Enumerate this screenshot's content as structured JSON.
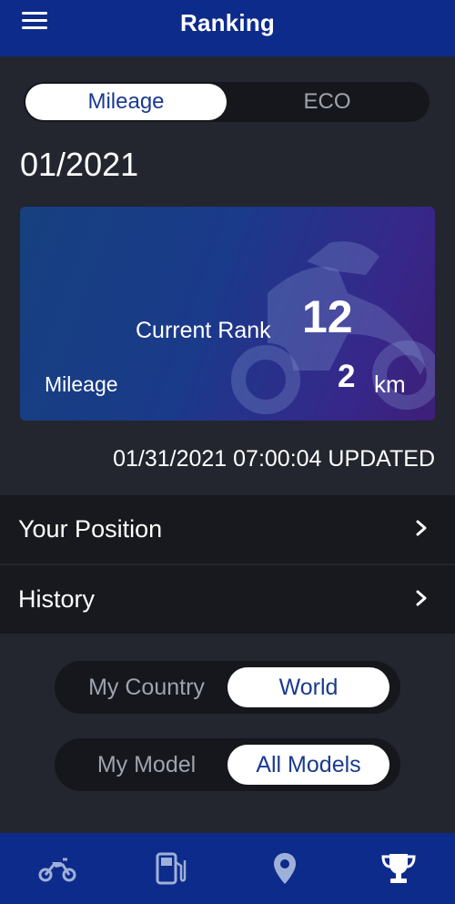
{
  "header": {
    "title": "Ranking",
    "menu_icon": "hamburger-menu-icon"
  },
  "metric_toggle": {
    "options": [
      "Mileage",
      "ECO"
    ],
    "selected": "Mileage"
  },
  "period": "01/2021",
  "rank_card": {
    "rank_label": "Current Rank",
    "rank_value": "12",
    "mileage_label": "Mileage",
    "mileage_value": "2",
    "mileage_unit": "km",
    "background_icon": "motorcycle-icon",
    "colors": {
      "start": "#16407f",
      "end": "#3d1f78"
    }
  },
  "updated_text": "01/31/2021 07:00:04 UPDATED",
  "rows": [
    {
      "label": "Your Position",
      "icon": "chevron-right-icon"
    },
    {
      "label": "History",
      "icon": "chevron-right-icon"
    }
  ],
  "region_toggle": {
    "options": [
      "My Country",
      "World"
    ],
    "selected": "World"
  },
  "model_toggle": {
    "options": [
      "My Model",
      "All Models"
    ],
    "selected": "All Models"
  },
  "tabbar": {
    "tabs": [
      {
        "icon": "motorcycle-icon",
        "active": false
      },
      {
        "icon": "fuel-pump-icon",
        "active": false
      },
      {
        "icon": "map-pin-icon",
        "active": false
      },
      {
        "icon": "trophy-icon",
        "active": true
      }
    ]
  },
  "colors": {
    "brand": "#0d2b8b",
    "background": "#23262e",
    "accent_text": "#1a3a8f"
  }
}
